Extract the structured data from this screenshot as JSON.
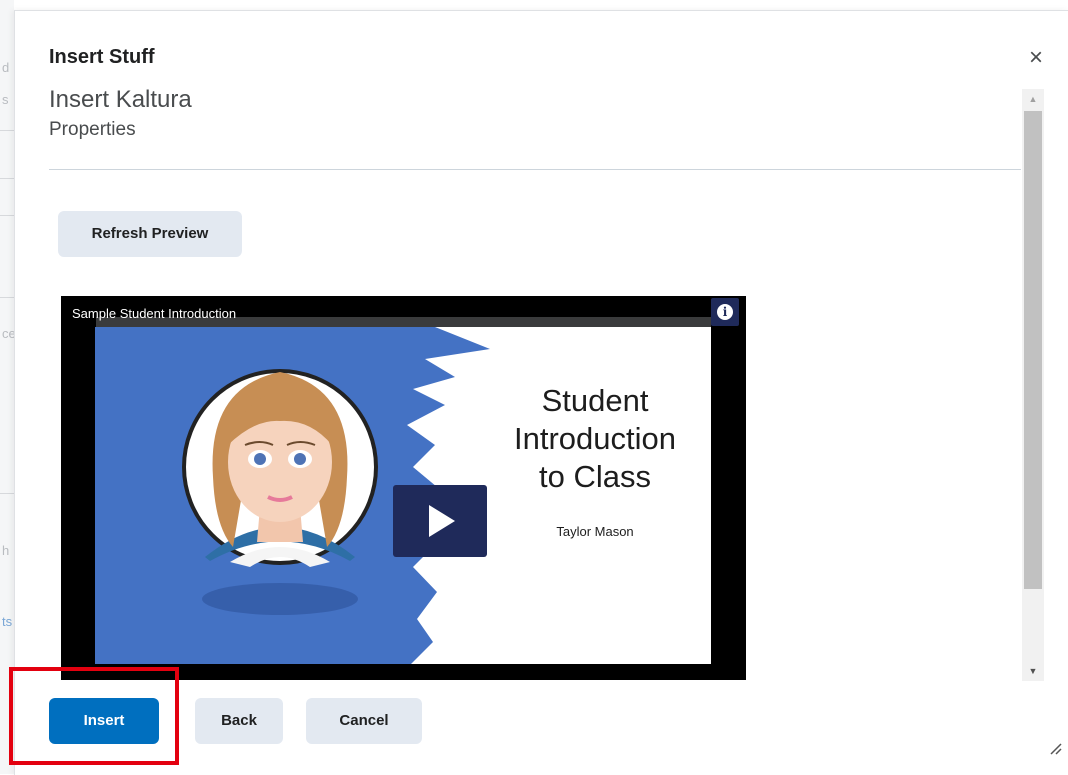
{
  "dialog": {
    "title": "Insert Stuff",
    "close_icon": "×",
    "subtitle": "Insert Kaltura",
    "section": "Properties"
  },
  "actions": {
    "refresh_label": "Refresh Preview",
    "insert_label": "Insert",
    "back_label": "Back",
    "cancel_label": "Cancel"
  },
  "video": {
    "title": "Sample Student Introduction",
    "info_icon": "i",
    "slide_heading": "Student Introduction to Class",
    "slide_heading_lines": [
      "Student",
      "Introduction",
      "to Class"
    ],
    "presenter": "Taylor Mason"
  },
  "background_fragments": [
    "d",
    "s",
    "ce",
    "h",
    "ts"
  ],
  "colors": {
    "primary": "#006fbf",
    "secondary_button": "#e3e9f1",
    "highlight": "#e3000f",
    "slide_blue": "#4472c4",
    "play_button": "#1f2a5a"
  },
  "icons": {
    "close": "close-icon",
    "info": "info-icon",
    "play": "play-icon",
    "scroll_up": "arrow-up-icon",
    "scroll_down": "arrow-down-icon",
    "resize": "resize-handle-icon"
  }
}
